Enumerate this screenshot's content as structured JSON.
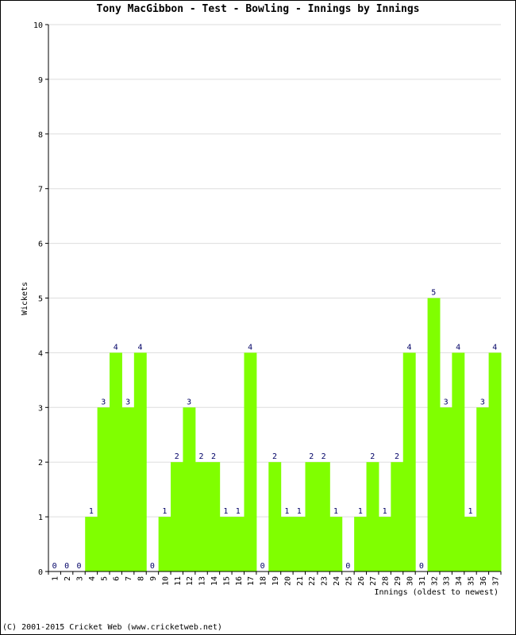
{
  "chart_data": {
    "type": "bar",
    "title": "Tony MacGibbon - Test - Bowling - Innings by Innings",
    "xlabel": "Innings (oldest to newest)",
    "ylabel": "Wickets",
    "ylim": [
      0,
      10
    ],
    "yticks": [
      0,
      1,
      2,
      3,
      4,
      5,
      6,
      7,
      8,
      9,
      10
    ],
    "grid": true,
    "categories": [
      "1",
      "2",
      "3",
      "4",
      "5",
      "6",
      "7",
      "8",
      "9",
      "10",
      "11",
      "12",
      "13",
      "14",
      "15",
      "16",
      "17",
      "18",
      "19",
      "20",
      "21",
      "22",
      "23",
      "24",
      "25",
      "26",
      "27",
      "28",
      "29",
      "30",
      "31",
      "32",
      "33",
      "34",
      "35",
      "36",
      "37"
    ],
    "values": [
      0,
      0,
      0,
      1,
      3,
      4,
      3,
      4,
      0,
      1,
      2,
      3,
      2,
      2,
      1,
      1,
      4,
      0,
      2,
      1,
      1,
      2,
      2,
      1,
      0,
      1,
      2,
      1,
      2,
      4,
      0,
      5,
      3,
      4,
      1,
      3,
      4
    ],
    "bar_color": "#80ff00",
    "label_color": "#000066",
    "grid_color": "#dddddd"
  },
  "footer": "(C) 2001-2015 Cricket Web (www.cricketweb.net)"
}
